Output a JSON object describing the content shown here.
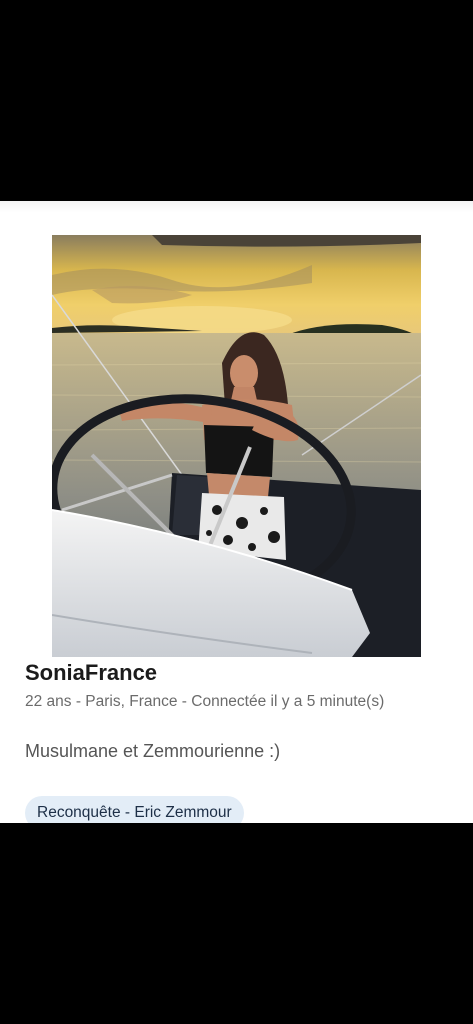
{
  "profile": {
    "photo_alt": "profile-photo",
    "name": "SoniaFrance",
    "meta": "22 ans - Paris, France - Connectée il y a 5 minute(s)",
    "bio": "Musulmane et Zemmourienne :)",
    "tags": [
      "Reconquête - Eric Zemmour"
    ]
  },
  "colors": {
    "background": "#000000",
    "card": "#ffffff",
    "name": "#1b1b1b",
    "meta": "#6b6b6b",
    "tag_bg": "#e3edf7",
    "tag_text": "#1d2f47"
  }
}
